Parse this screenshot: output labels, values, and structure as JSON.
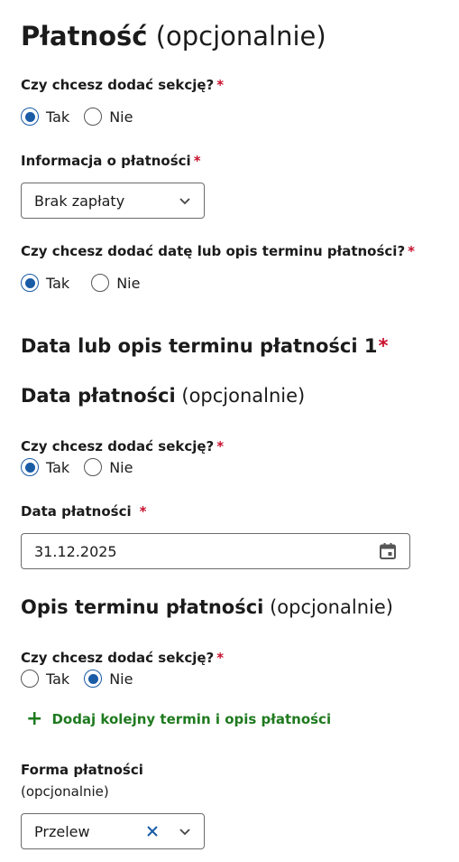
{
  "payment": {
    "title": "Płatność",
    "optional": "(opcjonalnie)",
    "add_section_q": "Czy chcesz dodać sekcję?",
    "yes": "Tak",
    "no": "Nie",
    "info_label": "Informacja o płatności",
    "info_value": "Brak zapłaty",
    "add_date_q": "Czy chcesz dodać datę lub opis terminu płatności?"
  },
  "term": {
    "title": "Data lub opis terminu płatności 1",
    "date_section_title": "Data płatności",
    "date_section_optional": "(opcjonalnie)",
    "date_add_q": "Czy chcesz dodać sekcję?",
    "date_label": "Data płatności",
    "date_value": "31.12.2025",
    "desc_title": "Opis terminu płatności",
    "desc_optional": "(opcjonalnie)",
    "desc_add_q": "Czy chcesz dodać sekcję?",
    "add_more_link": "Dodaj kolejny termin i opis płatności"
  },
  "method": {
    "label": "Forma płatności",
    "optional": "(opcjonalnie)",
    "value": "Przelew"
  },
  "colors": {
    "accent": "#1a5ba6",
    "required": "#c8102e",
    "link": "#1f7a1f"
  }
}
